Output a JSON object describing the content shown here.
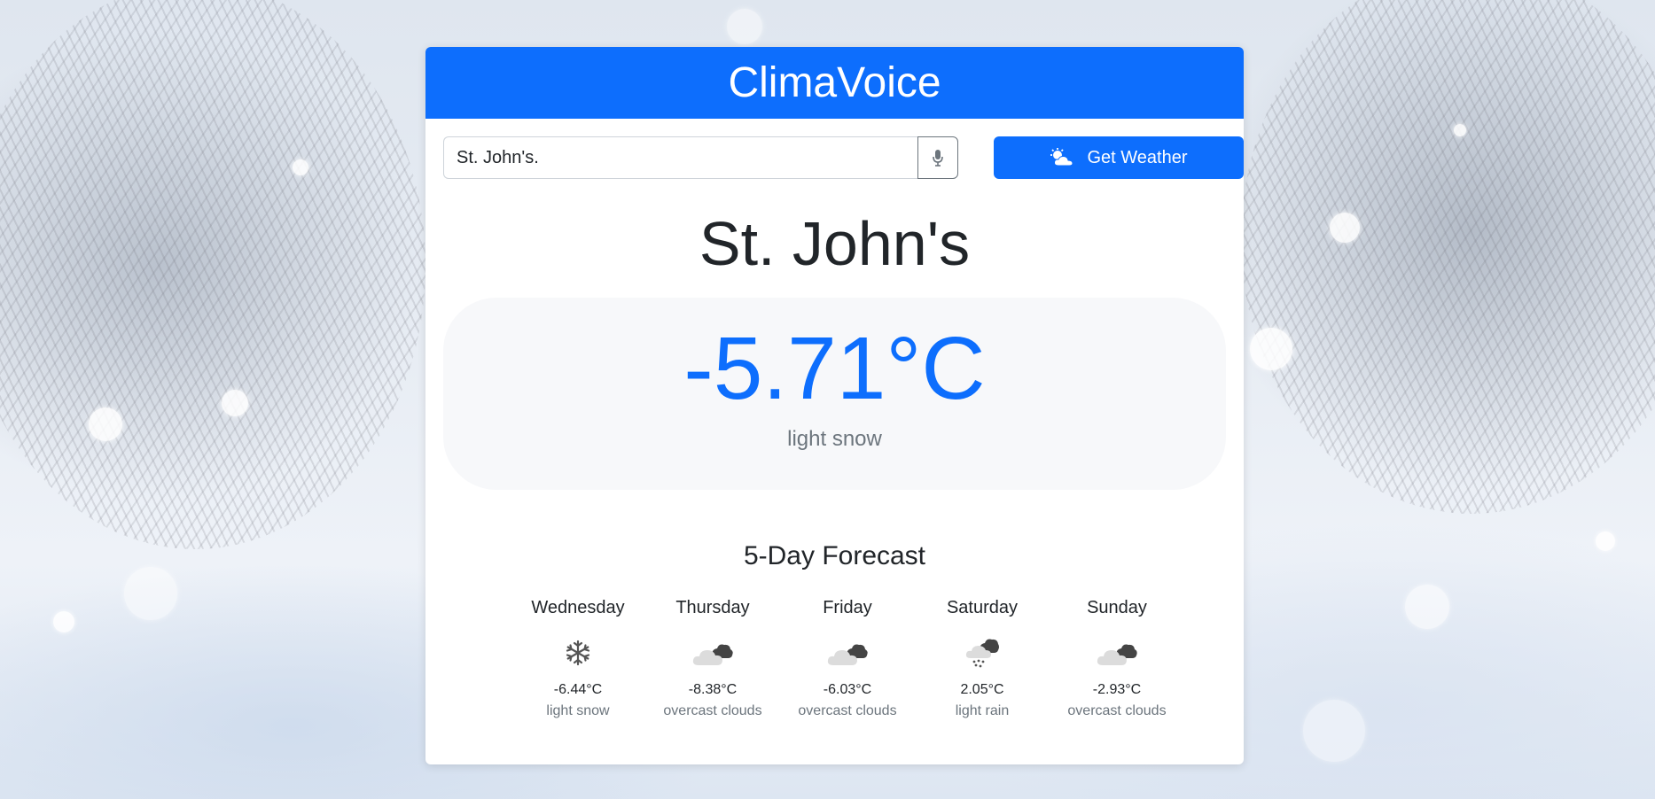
{
  "app": {
    "title": "ClimaVoice"
  },
  "search": {
    "value": "St. John's.",
    "mic_icon": "microphone-icon",
    "button_label": "Get Weather",
    "button_icon": "cloud-sun-icon"
  },
  "current": {
    "city": "St. John's",
    "temperature": "-5.71°C",
    "description": "light snow"
  },
  "forecast": {
    "title": "5-Day Forecast",
    "days": [
      {
        "day": "Wednesday",
        "icon": "snowflake-icon",
        "temp": "-6.44°C",
        "desc": "light snow"
      },
      {
        "day": "Thursday",
        "icon": "overcast-clouds-icon",
        "temp": "-8.38°C",
        "desc": "overcast clouds"
      },
      {
        "day": "Friday",
        "icon": "overcast-clouds-icon",
        "temp": "-6.03°C",
        "desc": "overcast clouds"
      },
      {
        "day": "Saturday",
        "icon": "light-rain-icon",
        "temp": "2.05°C",
        "desc": "light rain"
      },
      {
        "day": "Sunday",
        "icon": "overcast-clouds-icon",
        "temp": "-2.93°C",
        "desc": "overcast clouds"
      }
    ]
  },
  "colors": {
    "primary": "#0d6efd",
    "background_panel": "#f7f8fa",
    "muted_text": "#6c757d"
  }
}
